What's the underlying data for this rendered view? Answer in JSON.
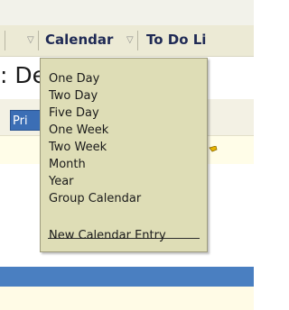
{
  "nav": {
    "items": [
      {
        "label": "Calendar",
        "has_dropdown": true
      },
      {
        "label": "To Do Li",
        "has_dropdown": false
      }
    ]
  },
  "page": {
    "heading": ": De",
    "button_label": "Pri"
  },
  "calendar_menu": {
    "items": [
      "One Day",
      "Two Day",
      "Five Day",
      "One Week",
      "Two Week",
      "Month",
      "Year",
      "Group Calendar"
    ],
    "footer_item": "New Calendar Entry"
  },
  "colors": {
    "menu_bg": "#deddb6",
    "nav_text": "#1f2a55",
    "accent_blue": "#4a7fc1"
  }
}
